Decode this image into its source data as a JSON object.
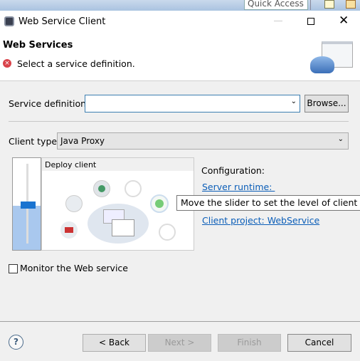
{
  "background": {
    "quick_access": "Quick Access"
  },
  "window": {
    "title": "Web Service Client",
    "icon": "eclipse-dialog-icon"
  },
  "header": {
    "title": "Web Services",
    "message": "Select a service definition.",
    "message_icon": "error-icon"
  },
  "form": {
    "service_definition_label": "Service definition:",
    "service_definition_value": "",
    "browse_label": "Browse...",
    "client_type_label": "Client type:",
    "client_type_value": "Java Proxy",
    "slider_stage": "Deploy client",
    "configuration_label": "Configuration:",
    "server_runtime_link": "Server runtime: ",
    "client_project_link": "Client project: WebService",
    "tooltip": "Move the slider to set the level of client gen",
    "monitor_label": "Monitor the Web service",
    "monitor_checked": false
  },
  "buttons": {
    "back": "< Back",
    "next": "Next >",
    "finish": "Finish",
    "cancel": "Cancel"
  },
  "colors": {
    "link": "#0b5eb8",
    "slider_fill": "#a9c8ee",
    "slider_thumb": "#1a73d0"
  }
}
